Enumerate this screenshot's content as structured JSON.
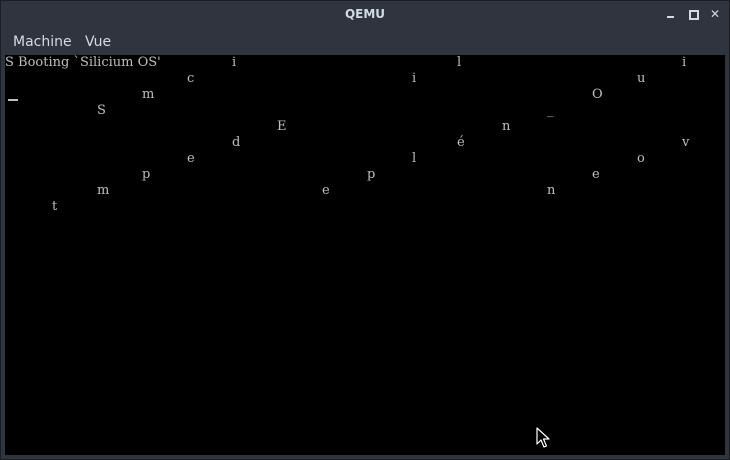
{
  "window": {
    "title": "QEMU"
  },
  "menubar": {
    "items": [
      {
        "label": "Machine"
      },
      {
        "label": "Vue"
      }
    ]
  },
  "console": {
    "boot_line": "S Booting `Silicium OS'",
    "chars": [
      "i",
      "l",
      "i",
      "c",
      "i",
      "u",
      "m",
      "O",
      "S",
      "_",
      "E",
      "n",
      "d",
      "é",
      "v",
      "e",
      "l",
      "o",
      "p",
      "p",
      "e",
      "m",
      "e",
      "n",
      "t"
    ]
  },
  "icons": {
    "minimize": "minimize-icon",
    "maximize": "maximize-icon",
    "close": "close-icon",
    "pointer": "mouse-pointer-icon"
  }
}
